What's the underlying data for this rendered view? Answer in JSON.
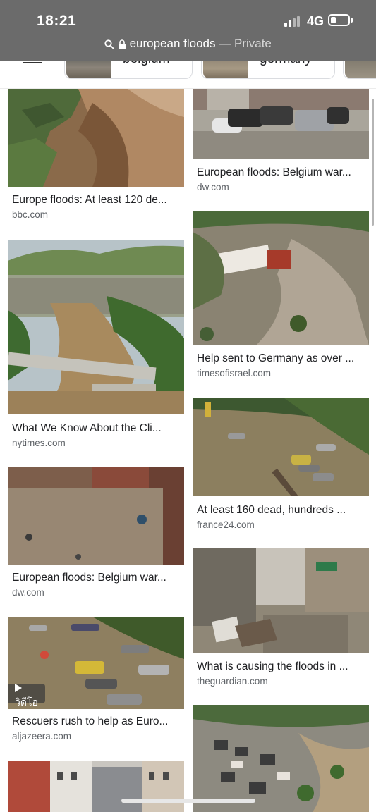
{
  "status_bar": {
    "time": "18:21",
    "network": "4G",
    "battery_level": 0.3
  },
  "browser": {
    "query": "european floods",
    "separator": " — ",
    "mode": "Private"
  },
  "chips": [
    {
      "label": "belgium"
    },
    {
      "label": "germany"
    }
  ],
  "left_column": [
    {
      "title": "Europe floods: At least 120 de...",
      "source": "bbc.com",
      "video": false
    },
    {
      "title": "What We Know About the Cli...",
      "source": "nytimes.com",
      "video": false
    },
    {
      "title": "European floods: Belgium war...",
      "source": "dw.com",
      "video": false
    },
    {
      "title": "Rescuers rush to help as Euro...",
      "source": "aljazeera.com",
      "video": true,
      "video_label": "วิดีโอ"
    },
    {
      "title": "",
      "source": "",
      "video": false
    }
  ],
  "right_column": [
    {
      "title": "European floods: Belgium war...",
      "source": "dw.com"
    },
    {
      "title": "Help sent to Germany as over ...",
      "source": "timesofisrael.com"
    },
    {
      "title": "At least 160 dead, hundreds ...",
      "source": "france24.com"
    },
    {
      "title": "What is causing the floods in ...",
      "source": "theguardian.com"
    },
    {
      "title": "",
      "source": ""
    }
  ],
  "icons": {
    "search": "search-icon",
    "lock": "lock-icon",
    "filter": "filter-icon",
    "play": "play-icon"
  }
}
